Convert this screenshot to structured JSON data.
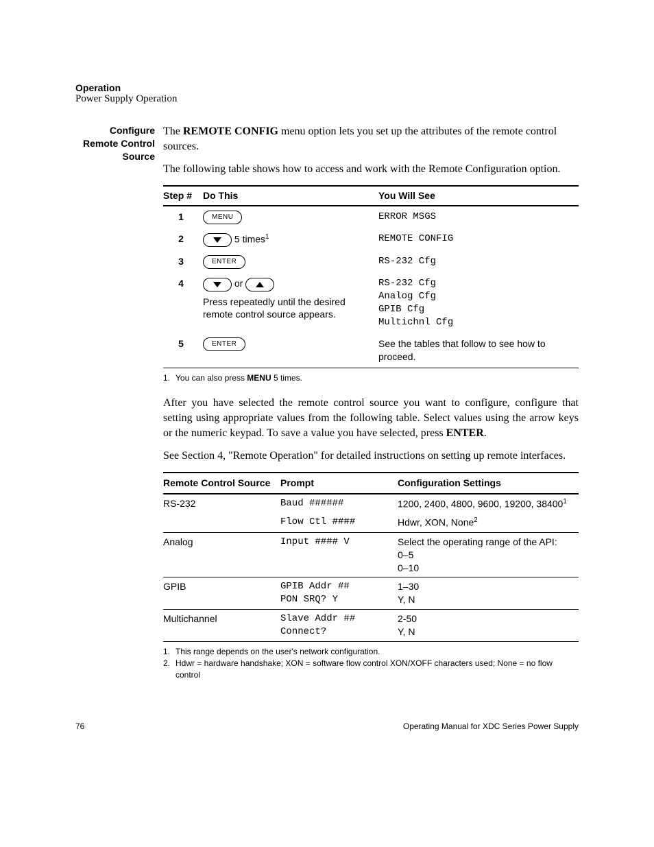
{
  "running_head": {
    "title": "Operation",
    "subtitle": "Power Supply Operation"
  },
  "sidehead": "Configure Remote Control Source",
  "intro": {
    "p1_pre": "The ",
    "p1_bold": "REMOTE CONFIG",
    "p1_post": " menu option lets you set up the attributes of the remote control sources.",
    "p2": "The following table shows how to access and work with the Remote Configuration option."
  },
  "steps_table": {
    "headers": {
      "step": "Step #",
      "do": "Do This",
      "see": "You Will See"
    },
    "rows": {
      "r1": {
        "num": "1",
        "key": "MENU",
        "see": "ERROR MSGS"
      },
      "r2": {
        "num": "2",
        "after_key": " 5 times",
        "sup": "1",
        "see": "REMOTE CONFIG"
      },
      "r3": {
        "num": "3",
        "key": "ENTER",
        "see": "RS-232 Cfg"
      },
      "r4": {
        "num": "4",
        "or": " or ",
        "desc": "Press repeatedly until the desired remote control source appears.",
        "see_l1": "RS-232 Cfg",
        "see_l2": "Analog Cfg",
        "see_l3": "GPIB Cfg",
        "see_l4": "Multichnl Cfg"
      },
      "r5": {
        "num": "5",
        "key": "ENTER",
        "see": "See the tables that follow to see how to proceed."
      }
    },
    "footnote": {
      "num": "1.",
      "pre": "You can also press ",
      "bold": "MENU",
      "post": " 5 times."
    }
  },
  "mid": {
    "p1_pre": "After you have selected the remote control source you want to configure, configure that setting using appropriate values from the following table. Select values using the arrow keys or the numeric keypad. To save a value you have selected, press ",
    "p1_bold": "ENTER",
    "p1_post": ".",
    "p2": "See Section 4, \"Remote Operation\" for detailed instructions on setting up remote interfaces."
  },
  "settings_table": {
    "headers": {
      "src": "Remote Control Source",
      "prompt": "Prompt",
      "cfg": "Configuration Settings"
    },
    "rs232": {
      "label": "RS-232",
      "p1": "Baud ######",
      "c1_pre": "1200, 2400, 4800, 9600, 19200, 38400",
      "c1_sup": "1",
      "p2": "Flow Ctl ####",
      "c2_pre": "Hdwr, XON, None",
      "c2_sup": "2"
    },
    "analog": {
      "label": "Analog",
      "p1": "Input #### V",
      "c1_l1": "Select the operating range of the API:",
      "c1_l2": "0–5",
      "c1_l3": "0–10"
    },
    "gpib": {
      "label": "GPIB",
      "p1": "GPIB Addr ##",
      "c1": "1–30",
      "p2": "PON SRQ? Y",
      "c2": "Y, N"
    },
    "multi": {
      "label": "Multichannel",
      "p1": "Slave Addr ##",
      "c1": "2-50",
      "p2": "Connect?",
      "c2": "Y, N"
    },
    "footnotes": {
      "f1_num": "1.",
      "f1": "This range depends on the user's network configuration.",
      "f2_num": "2.",
      "f2": "Hdwr = hardware handshake; XON = software flow control XON/XOFF characters used; None = no flow control"
    }
  },
  "footer": {
    "pagenum": "76",
    "manual": "Operating Manual for XDC Series Power Supply"
  }
}
